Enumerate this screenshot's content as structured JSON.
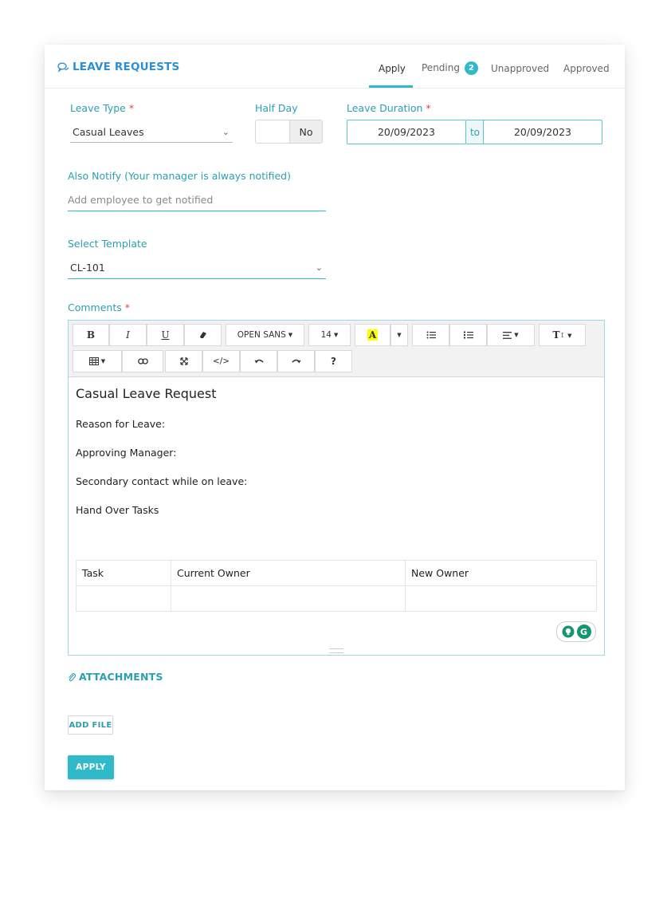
{
  "header": {
    "title": "LEAVE REQUESTS",
    "tabs": [
      {
        "label": "Apply"
      },
      {
        "label": "Pending",
        "badge": "2"
      },
      {
        "label": "Unapproved"
      },
      {
        "label": "Approved"
      }
    ]
  },
  "form": {
    "leave_type": {
      "label": "Leave Type",
      "required_mark": "*",
      "value": "Casual Leaves"
    },
    "half_day": {
      "label": "Half Day",
      "value": "No"
    },
    "leave_duration": {
      "label": "Leave Duration",
      "required_mark": "*",
      "from": "20/09/2023",
      "separator": "to",
      "to": "20/09/2023"
    },
    "also_notify": {
      "label": "Also Notify (Your manager is always notified)",
      "placeholder": "Add employee to get notified"
    },
    "template": {
      "label": "Select Template",
      "value": "CL-101"
    },
    "comments": {
      "label": "Comments",
      "required_mark": "*"
    }
  },
  "toolbar": {
    "font_family": "OPEN SANS",
    "font_size": "14",
    "highlight_letter": "A",
    "text_style_label": "T",
    "help_label": "?",
    "colors": {
      "highlight": "#ffff00"
    }
  },
  "editor": {
    "heading": "Casual Leave Request",
    "lines": [
      "Reason for Leave:",
      "Approving Manager:",
      "Secondary contact while on leave:",
      "Hand Over Tasks"
    ],
    "table": {
      "headers": [
        "Task",
        "Current Owner",
        "New Owner"
      ],
      "rows": [
        [
          "",
          "",
          ""
        ]
      ]
    },
    "grammarly_letter": "G"
  },
  "attachments": {
    "title": "ATTACHMENTS",
    "add_file_label": "ADD FILE"
  },
  "apply_button": "APPLY",
  "colors": {
    "accent": "#30b9c8",
    "label": "#2b9fb0",
    "title": "#2b8fd6",
    "required": "#e04848"
  }
}
